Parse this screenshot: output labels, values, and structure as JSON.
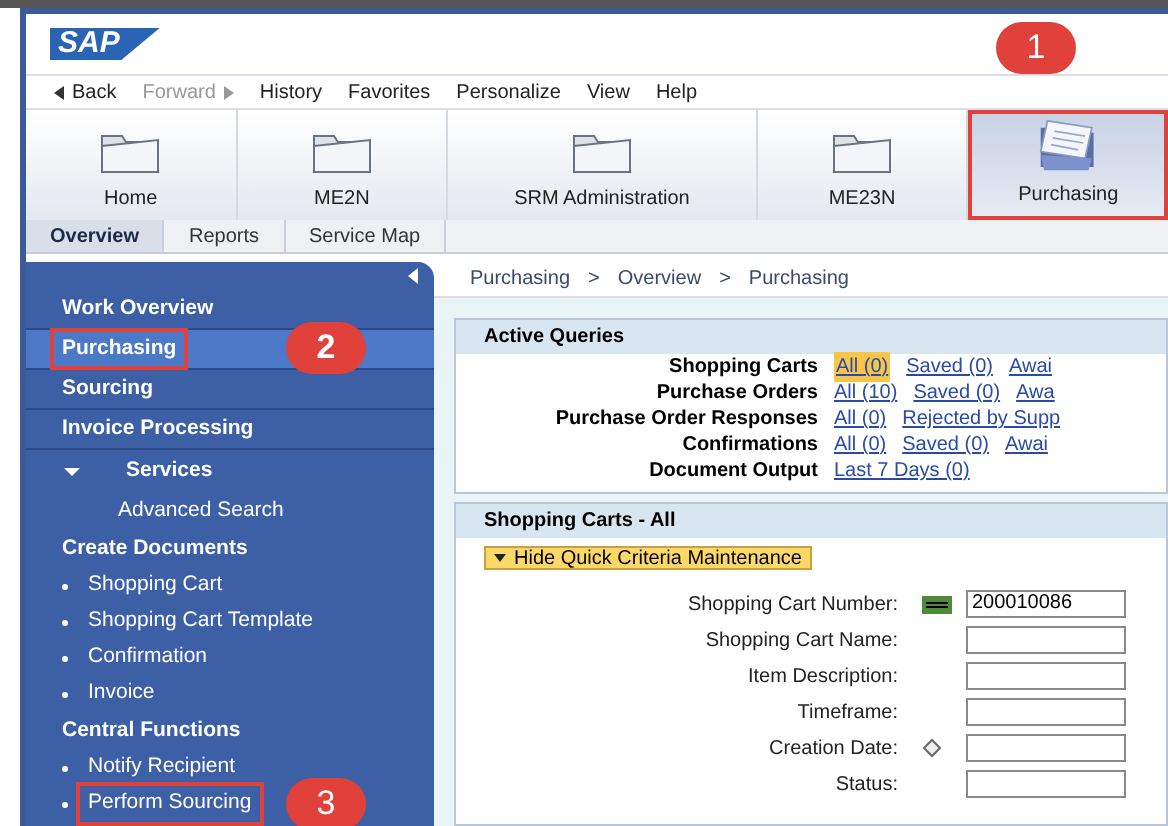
{
  "logo": "SAP",
  "nav": [
    {
      "label": "Back",
      "kind": "back",
      "disabled": false
    },
    {
      "label": "Forward",
      "kind": "forward",
      "disabled": true
    },
    {
      "label": "History",
      "kind": "plain",
      "disabled": false
    },
    {
      "label": "Favorites",
      "kind": "plain",
      "disabled": false
    },
    {
      "label": "Personalize",
      "kind": "plain",
      "disabled": false
    },
    {
      "label": "View",
      "kind": "plain",
      "disabled": false
    },
    {
      "label": "Help",
      "kind": "plain",
      "disabled": false
    }
  ],
  "launchpad": [
    {
      "label": "Home",
      "selected": false,
      "highlighted": false
    },
    {
      "label": "ME2N",
      "selected": false,
      "highlighted": false
    },
    {
      "label": "SRM Administration",
      "selected": false,
      "highlighted": false
    },
    {
      "label": "ME23N",
      "selected": false,
      "highlighted": false
    },
    {
      "label": "Purchasing",
      "selected": true,
      "highlighted": true,
      "callout": "1"
    }
  ],
  "subtabs": [
    {
      "label": "Overview",
      "selected": true
    },
    {
      "label": "Reports",
      "selected": false
    },
    {
      "label": "Service Map",
      "selected": false
    }
  ],
  "sidebar": [
    {
      "label": "Work Overview",
      "kind": "header",
      "selected": false,
      "highlighted": false
    },
    {
      "label": "Purchasing",
      "kind": "header",
      "selected": true,
      "highlighted": true,
      "callout": "2"
    },
    {
      "label": "Sourcing",
      "kind": "header",
      "selected": false,
      "highlighted": false
    },
    {
      "label": "Invoice Processing",
      "kind": "header",
      "selected": false,
      "highlighted": false
    },
    {
      "label": "Services",
      "kind": "expander",
      "selected": false,
      "highlighted": false
    },
    {
      "label": "Advanced Search",
      "kind": "sub",
      "selected": false,
      "highlighted": false
    },
    {
      "label": "Create Documents",
      "kind": "group",
      "selected": false,
      "highlighted": false
    },
    {
      "label": "Shopping Cart",
      "kind": "bullet",
      "selected": false,
      "highlighted": false
    },
    {
      "label": "Shopping Cart Template",
      "kind": "bullet",
      "selected": false,
      "highlighted": false
    },
    {
      "label": "Confirmation",
      "kind": "bullet",
      "selected": false,
      "highlighted": false
    },
    {
      "label": "Invoice",
      "kind": "bullet",
      "selected": false,
      "highlighted": false
    },
    {
      "label": "Central Functions",
      "kind": "group",
      "selected": false,
      "highlighted": false
    },
    {
      "label": "Notify Recipient",
      "kind": "bullet",
      "selected": false,
      "highlighted": false
    },
    {
      "label": "Perform Sourcing",
      "kind": "bullet",
      "selected": false,
      "highlighted": true,
      "callout": "3"
    }
  ],
  "breadcrumb": [
    "Purchasing",
    ">",
    "Overview",
    ">",
    "Purchasing"
  ],
  "active_queries": {
    "title": "Active Queries",
    "rows": [
      {
        "label": "Shopping Carts",
        "links": [
          {
            "text": "All (0)",
            "selected": true
          },
          {
            "text": "Saved (0)",
            "selected": false
          },
          {
            "text": "Awai",
            "selected": false
          }
        ]
      },
      {
        "label": "Purchase Orders",
        "links": [
          {
            "text": "All (10)",
            "selected": false
          },
          {
            "text": "Saved (0)",
            "selected": false
          },
          {
            "text": "Awa",
            "selected": false
          }
        ]
      },
      {
        "label": "Purchase Order Responses",
        "links": [
          {
            "text": "All (0)",
            "selected": false
          },
          {
            "text": "Rejected by Supp",
            "selected": false
          }
        ]
      },
      {
        "label": "Confirmations",
        "links": [
          {
            "text": "All (0)",
            "selected": false
          },
          {
            "text": "Saved (0)",
            "selected": false
          },
          {
            "text": "Awai",
            "selected": false
          }
        ]
      },
      {
        "label": "Document Output",
        "links": [
          {
            "text": "Last 7 Days (0)",
            "selected": false
          }
        ]
      }
    ]
  },
  "carts": {
    "title": "Shopping Carts - All",
    "toggle": "Hide Quick Criteria Maintenance",
    "fields": [
      {
        "label": "Shopping Cart Number:",
        "kind": "equals",
        "value": "200010086"
      },
      {
        "label": "Shopping Cart Name:",
        "kind": "plain"
      },
      {
        "label": "Item Description:",
        "kind": "plain"
      },
      {
        "label": "Timeframe:",
        "kind": "plain"
      },
      {
        "label": "Creation Date:",
        "kind": "diamond"
      },
      {
        "label": "Status:",
        "kind": "plain"
      }
    ]
  }
}
